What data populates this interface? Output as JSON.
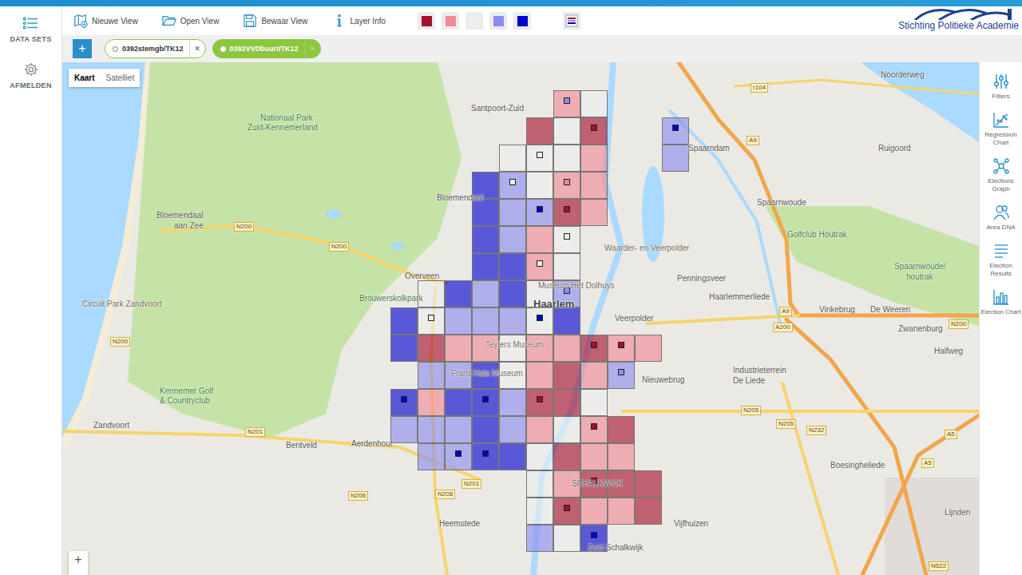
{
  "toolbar": {
    "actions": [
      {
        "label": "Nieuwe View",
        "kind": "new"
      },
      {
        "label": "Open View",
        "kind": "open"
      },
      {
        "label": "Bewaar View",
        "kind": "save"
      },
      {
        "label": "Layer Info",
        "kind": "info"
      }
    ],
    "legend": [
      {
        "color": "#a50f2b"
      },
      {
        "color": "#f08a94"
      },
      {
        "color": "#eeeeee"
      },
      {
        "color": "#8c8cf0"
      },
      {
        "color": "#0000d0"
      }
    ],
    "logo": "Stichting Politieke Academie"
  },
  "sidebar": {
    "items": [
      {
        "label": "DATA SETS",
        "kind": "list"
      },
      {
        "label": "AFMELDEN",
        "kind": "gear"
      }
    ]
  },
  "add_button": "+",
  "layers": [
    {
      "label": "0392stemgb/TK12",
      "selected": false,
      "close": "×"
    },
    {
      "label": "0392VVDbuurt/TK12",
      "selected": true,
      "close": "×"
    }
  ],
  "map": {
    "toggle": [
      {
        "label": "Kaart",
        "selected": true
      },
      {
        "label": "Satelliet",
        "selected": false
      }
    ],
    "zoom": "+",
    "labels": [
      {
        "text": "Santpoort-Zuid",
        "kind": "place"
      },
      {
        "text": "Nationaal Park",
        "kind": "park"
      },
      {
        "text": "Zuid-Kennemerland",
        "kind": "park"
      },
      {
        "text": "Spaarndam",
        "kind": "place"
      },
      {
        "text": "Ruigoord",
        "kind": "place"
      },
      {
        "text": "Spaarnwoude",
        "kind": "place"
      },
      {
        "text": "Bloemendaal",
        "kind": "place"
      },
      {
        "text": "Bloemendaal",
        "kind": "place"
      },
      {
        "text": "aan Zee",
        "kind": "place"
      },
      {
        "text": "Waarder- en Veerpolder",
        "kind": "poi"
      },
      {
        "text": "Golfclub Houtrak",
        "kind": "park"
      },
      {
        "text": "Spaarnwoude/",
        "kind": "park"
      },
      {
        "text": "houtrak",
        "kind": "park"
      },
      {
        "text": "Penningsveer",
        "kind": "place"
      },
      {
        "text": "Overveen",
        "kind": "place"
      },
      {
        "text": "Brouwerskolkpark",
        "kind": "park"
      },
      {
        "text": "Museum Het Dolhuys",
        "kind": "poi"
      },
      {
        "text": "Haarlem",
        "kind": "city"
      },
      {
        "text": "Haarlemmerliede",
        "kind": "place"
      },
      {
        "text": "Circuit Park Zandvoort",
        "kind": "poi"
      },
      {
        "text": "Veerpolder",
        "kind": "place"
      },
      {
        "text": "Vinkebrug",
        "kind": "place"
      },
      {
        "text": "De Weeren",
        "kind": "place"
      },
      {
        "text": "Zwanenburg",
        "kind": "place"
      },
      {
        "text": "Halfweg",
        "kind": "place"
      },
      {
        "text": "Teylers Museum",
        "kind": "poi"
      },
      {
        "text": "Frans Hals Museum",
        "kind": "poi"
      },
      {
        "text": "Nieuwebrug",
        "kind": "place"
      },
      {
        "text": "Industrieterrein",
        "kind": "place"
      },
      {
        "text": "De Liede",
        "kind": "place"
      },
      {
        "text": "Kennemer Golf",
        "kind": "park"
      },
      {
        "text": "& Countryclub",
        "kind": "park"
      },
      {
        "text": "Zandvoort",
        "kind": "place"
      },
      {
        "text": "Bentveld",
        "kind": "place"
      },
      {
        "text": "Aerdenhout",
        "kind": "place"
      },
      {
        "text": "Boesingheliede",
        "kind": "place"
      },
      {
        "text": "SCHALKWIJK",
        "kind": "place"
      },
      {
        "text": "Heemstede",
        "kind": "place"
      },
      {
        "text": "Vijfhuizen",
        "kind": "place"
      },
      {
        "text": "Lijnden",
        "kind": "place"
      },
      {
        "text": "Zuid-Schalkwijk",
        "kind": "place"
      },
      {
        "text": "N200",
        "kind": "road"
      },
      {
        "text": "N200",
        "kind": "road"
      },
      {
        "text": "N200",
        "kind": "road"
      },
      {
        "text": "N200",
        "kind": "road"
      },
      {
        "text": "A9",
        "kind": "road"
      },
      {
        "text": "A9",
        "kind": "road"
      },
      {
        "text": "A200",
        "kind": "road"
      },
      {
        "text": "r104",
        "kind": "road"
      },
      {
        "text": "N205",
        "kind": "road"
      },
      {
        "text": "N205",
        "kind": "road"
      },
      {
        "text": "N201",
        "kind": "road"
      },
      {
        "text": "N201",
        "kind": "road"
      },
      {
        "text": "N208",
        "kind": "road"
      },
      {
        "text": "N206",
        "kind": "road"
      },
      {
        "text": "N232",
        "kind": "road"
      },
      {
        "text": "A5",
        "kind": "road"
      },
      {
        "text": "A5",
        "kind": "road"
      },
      {
        "text": "N522",
        "kind": "road"
      },
      {
        "text": "Noorderweg",
        "kind": "place"
      }
    ],
    "grid": {
      "rows": [
        [
          null,
          null,
          null,
          null,
          null,
          null,
          1,
          2,
          null,
          null,
          null
        ],
        [
          null,
          null,
          null,
          null,
          null,
          0,
          2,
          0,
          null,
          null,
          3
        ],
        [
          null,
          null,
          null,
          null,
          2,
          2,
          2,
          1,
          null,
          null,
          3
        ],
        [
          null,
          null,
          null,
          4,
          3,
          2,
          1,
          1,
          null,
          null,
          null
        ],
        [
          null,
          null,
          null,
          4,
          3,
          3,
          0,
          1,
          null,
          null,
          null
        ],
        [
          null,
          null,
          null,
          4,
          3,
          1,
          2,
          null,
          null,
          null,
          null
        ],
        [
          null,
          null,
          null,
          4,
          4,
          1,
          2,
          null,
          null,
          null,
          null
        ],
        [
          null,
          2,
          4,
          3,
          4,
          2,
          3,
          null,
          null,
          null,
          null
        ],
        [
          4,
          2,
          3,
          3,
          3,
          2,
          4,
          null,
          null,
          null,
          null
        ],
        [
          4,
          0,
          1,
          1,
          2,
          1,
          1,
          0,
          1,
          1,
          null
        ],
        [
          null,
          3,
          3,
          4,
          2,
          1,
          0,
          1,
          3,
          null,
          null
        ],
        [
          4,
          1,
          4,
          4,
          3,
          0,
          0,
          2,
          null,
          null,
          null
        ],
        [
          3,
          3,
          3,
          4,
          3,
          1,
          2,
          1,
          0,
          null,
          null
        ],
        [
          null,
          3,
          3,
          4,
          4,
          2,
          0,
          1,
          1,
          null,
          null
        ],
        [
          null,
          null,
          null,
          null,
          null,
          2,
          1,
          0,
          0,
          0,
          null
        ],
        [
          null,
          null,
          null,
          null,
          null,
          2,
          0,
          1,
          1,
          0,
          null
        ],
        [
          null,
          null,
          null,
          null,
          null,
          3,
          2,
          4,
          null,
          null,
          null
        ]
      ]
    },
    "markers": [
      {
        "row": 0,
        "col": 6,
        "level": 3
      },
      {
        "row": 1,
        "col": 7,
        "level": 0
      },
      {
        "row": 1,
        "col": 10,
        "level": 4
      },
      {
        "row": 2,
        "col": 5,
        "level": 2
      },
      {
        "row": 3,
        "col": 4,
        "level": 2
      },
      {
        "row": 3,
        "col": 6,
        "level": 1
      },
      {
        "row": 4,
        "col": 5,
        "level": 4
      },
      {
        "row": 4,
        "col": 6,
        "level": 0
      },
      {
        "row": 5,
        "col": 6,
        "level": 2
      },
      {
        "row": 6,
        "col": 5,
        "level": 2
      },
      {
        "row": 7,
        "col": 6,
        "level": 3
      },
      {
        "row": 8,
        "col": 1,
        "level": 2
      },
      {
        "row": 8,
        "col": 5,
        "level": 4
      },
      {
        "row": 9,
        "col": 7,
        "level": 0
      },
      {
        "row": 9,
        "col": 8,
        "level": 0
      },
      {
        "row": 10,
        "col": 8,
        "level": 3
      },
      {
        "row": 11,
        "col": 0,
        "level": 4
      },
      {
        "row": 11,
        "col": 3,
        "level": 4
      },
      {
        "row": 11,
        "col": 5,
        "level": 0
      },
      {
        "row": 12,
        "col": 7,
        "level": 0
      },
      {
        "row": 13,
        "col": 2,
        "level": 4
      },
      {
        "row": 13,
        "col": 3,
        "level": 4
      },
      {
        "row": 14,
        "col": 7,
        "level": 0
      },
      {
        "row": 15,
        "col": 6,
        "level": 0
      },
      {
        "row": 16,
        "col": 7,
        "level": 4
      }
    ]
  },
  "tools": [
    {
      "label": "Filters",
      "kind": "filters"
    },
    {
      "label": "Regression Chart",
      "kind": "regression"
    },
    {
      "label": "Elections Graph",
      "kind": "graph"
    },
    {
      "label": "Area DNA",
      "kind": "dna"
    },
    {
      "label": "Election Results",
      "kind": "results"
    },
    {
      "label": "Election Chart",
      "kind": "chart"
    }
  ]
}
